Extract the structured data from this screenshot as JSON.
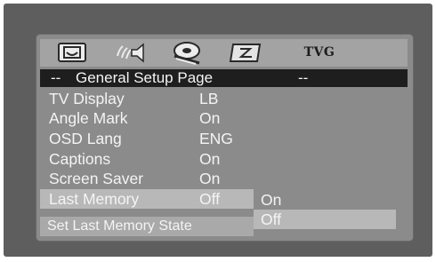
{
  "icon_bar": {
    "icons": [
      "general-setup-icon",
      "audio-setup-icon",
      "video-setup-icon",
      "preference-icon",
      "tvg-icon"
    ],
    "tvg_label": "TVG"
  },
  "title_bar": {
    "prefix": "--",
    "text": "General Setup Page",
    "suffix": "--"
  },
  "menu": {
    "items": [
      {
        "label": "TV Display",
        "value": "LB"
      },
      {
        "label": "Angle Mark",
        "value": "On"
      },
      {
        "label": "OSD Lang",
        "value": "ENG"
      },
      {
        "label": "Captions",
        "value": "On"
      },
      {
        "label": "Screen Saver",
        "value": "On"
      },
      {
        "label": "Last Memory",
        "value": "Off"
      }
    ],
    "selected": "Last Memory"
  },
  "submenu": {
    "options": [
      "On",
      "Off"
    ],
    "selected": "Off"
  },
  "status_text": "Set Last Memory State",
  "colors": {
    "frame": "#5e5e5e",
    "screen": "#8b8b8b",
    "title_bar": "#1e1e1e",
    "highlight": "#b8b8b8",
    "text": "#f4f4f4"
  }
}
